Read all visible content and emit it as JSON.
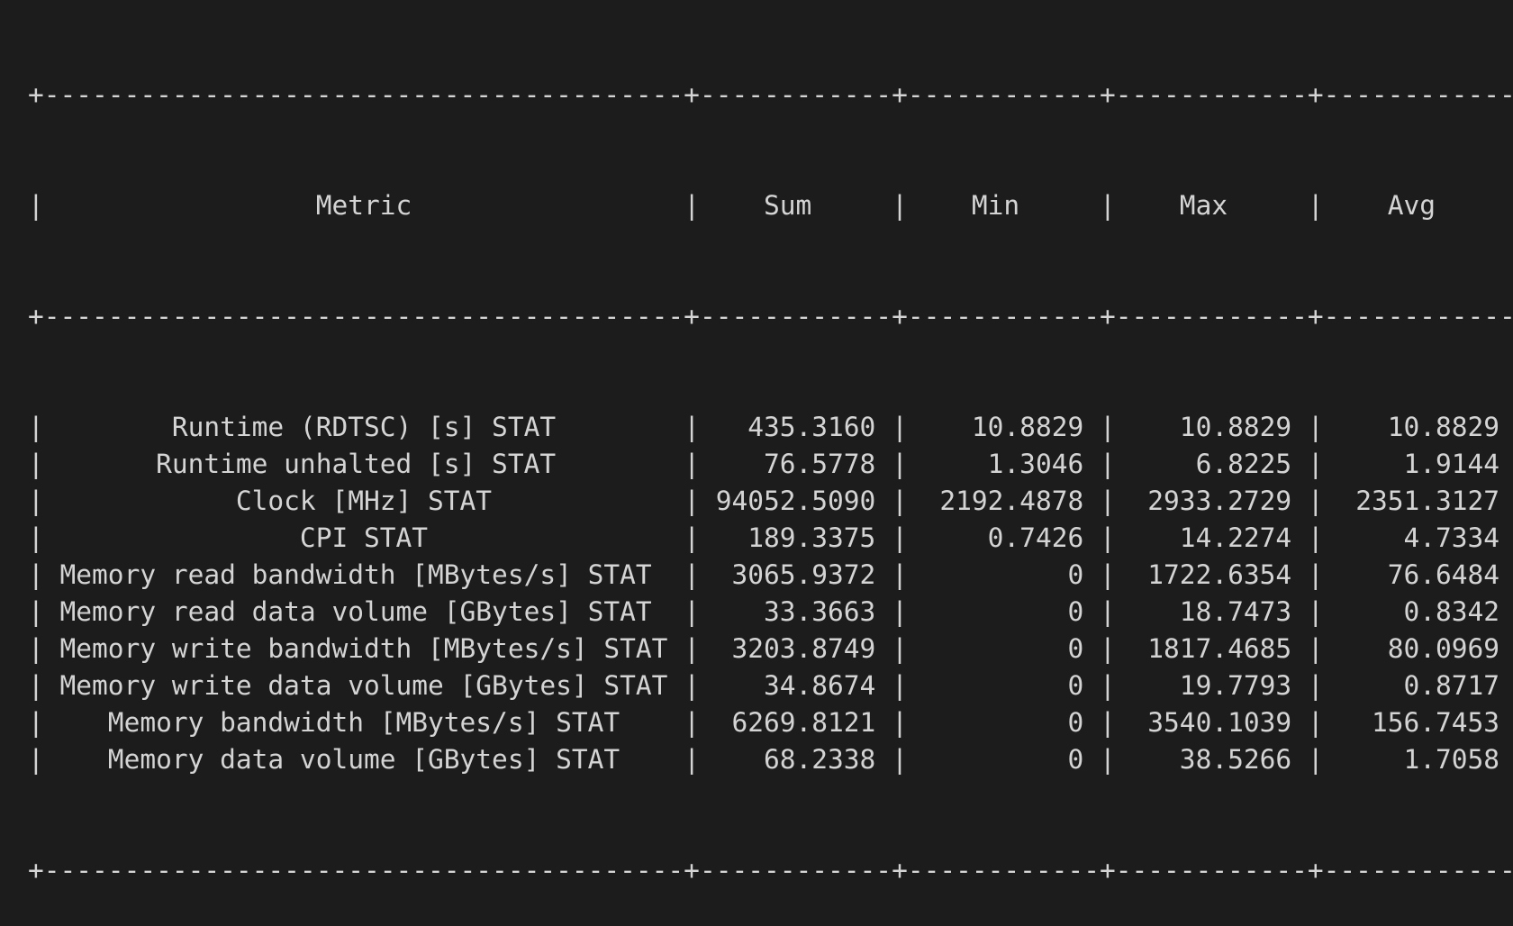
{
  "table": {
    "headers": [
      "Metric",
      "Sum",
      "Min",
      "Max",
      "Avg"
    ],
    "rows": [
      [
        "Runtime (RDTSC) [s] STAT",
        "435.3160",
        "10.8829",
        "10.8829",
        "10.8829"
      ],
      [
        "Runtime unhalted [s] STAT",
        "76.5778",
        "1.3046",
        "6.8225",
        "1.9144"
      ],
      [
        "Clock [MHz] STAT",
        "94052.5090",
        "2192.4878",
        "2933.2729",
        "2351.3127"
      ],
      [
        "CPI STAT",
        "189.3375",
        "0.7426",
        "14.2274",
        "4.7334"
      ],
      [
        "Memory read bandwidth [MBytes/s] STAT",
        "3065.9372",
        "0",
        "1722.6354",
        "76.6484"
      ],
      [
        "Memory read data volume [GBytes] STAT",
        "33.3663",
        "0",
        "18.7473",
        "0.8342"
      ],
      [
        "Memory write bandwidth [MBytes/s] STAT",
        "3203.8749",
        "0",
        "1817.4685",
        "80.0969"
      ],
      [
        "Memory write data volume [GBytes] STAT",
        "34.8674",
        "0",
        "19.7793",
        "0.8717"
      ],
      [
        "Memory bandwidth [MBytes/s] STAT",
        "6269.8121",
        "0",
        "3540.1039",
        "156.7453"
      ],
      [
        "Memory data volume [GBytes] STAT",
        "68.2338",
        "0",
        "38.5266",
        "1.7058"
      ]
    ]
  },
  "colors": {
    "background": "#1c1c1c",
    "foreground": "#d4d4d4"
  }
}
